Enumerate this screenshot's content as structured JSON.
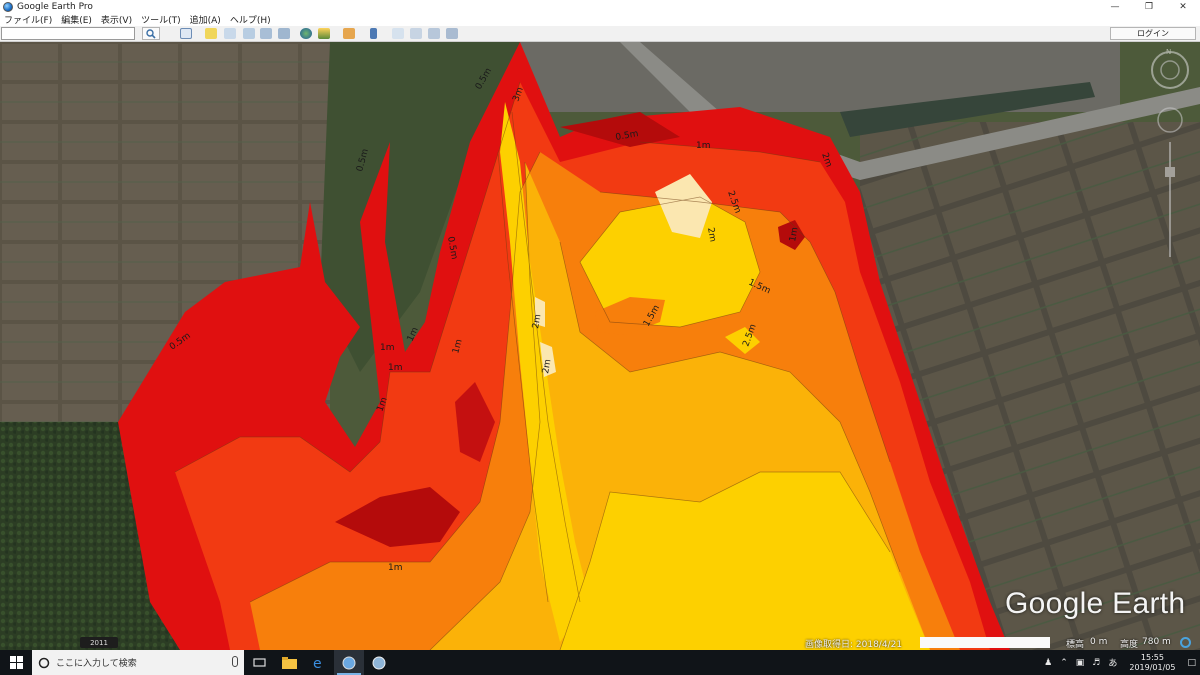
{
  "window": {
    "title": "Google Earth Pro",
    "minimize": "—",
    "maximize": "❐",
    "close": "✕"
  },
  "menu": [
    "ファイル(F)",
    "編集(E)",
    "表示(V)",
    "ツール(T)",
    "追加(A)",
    "ヘルプ(H)"
  ],
  "toolbar": {
    "search_value": "",
    "login_label": "ログイン"
  },
  "map": {
    "contour_labels": [
      "0.5m",
      "0.5m",
      "0.5m",
      "0.5m",
      "0.5m",
      "1m",
      "1m",
      "1m",
      "1m",
      "1m",
      "1m",
      "1m",
      "1.5m",
      "1.5m",
      "2m",
      "2m",
      "2m",
      "2m",
      "2.5m",
      "2.5m",
      "3m",
      "1m"
    ],
    "brand": "Google Earth",
    "depth_colors": {
      "0.5m": "#e01010",
      "1m": "#f23a12",
      "1.5m": "#f77f0c",
      "2m": "#fbb208",
      "2.5m": "#fdd000",
      "3m": "#fbe7b0",
      "deep": "#b40b0b"
    }
  },
  "status": {
    "year_tag": "2011",
    "imagery_date": "画像取得日: 2018/4/21",
    "elevation_label": "標高",
    "elevation_value": "0 m",
    "altitude_label": "高度",
    "altitude_value": "780 m"
  },
  "taskbar": {
    "search_placeholder": "ここに入力して検索",
    "ime": "あ",
    "time": "15:55",
    "date": "2019/01/05"
  }
}
